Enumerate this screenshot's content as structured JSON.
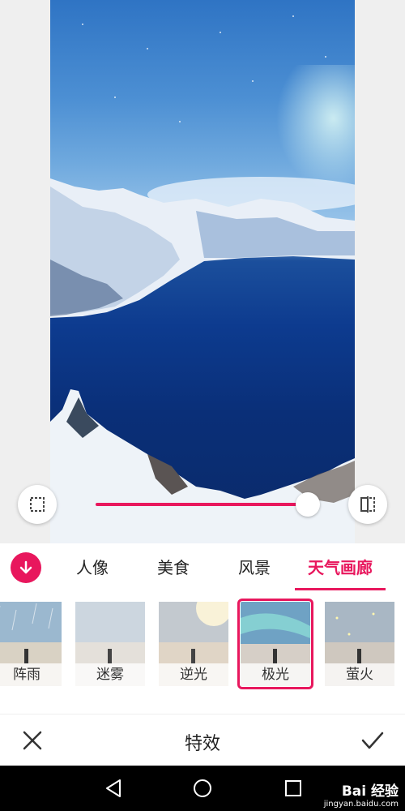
{
  "preview": {
    "intensity": 0.9
  },
  "category_tabs": [
    {
      "label": "人像",
      "active": false
    },
    {
      "label": "美食",
      "active": false
    },
    {
      "label": "风景",
      "active": false
    },
    {
      "label": "天气画廊",
      "active": true
    }
  ],
  "effects": [
    {
      "label": "阵雨",
      "selected": false
    },
    {
      "label": "迷雾",
      "selected": false
    },
    {
      "label": "逆光",
      "selected": false
    },
    {
      "label": "极光",
      "selected": true
    },
    {
      "label": "萤火",
      "selected": false
    }
  ],
  "bottom_bar": {
    "title": "特效"
  },
  "watermark": {
    "brand": "Bai 经验",
    "url": "jingyan.baidu.com"
  },
  "colors": {
    "accent": "#e8175d"
  },
  "icons": [
    "crop-frame-icon",
    "compare-split-icon",
    "collapse-arrow-icon",
    "cancel-x-icon",
    "confirm-check-icon",
    "nav-back-icon",
    "nav-home-icon",
    "nav-recents-icon"
  ]
}
